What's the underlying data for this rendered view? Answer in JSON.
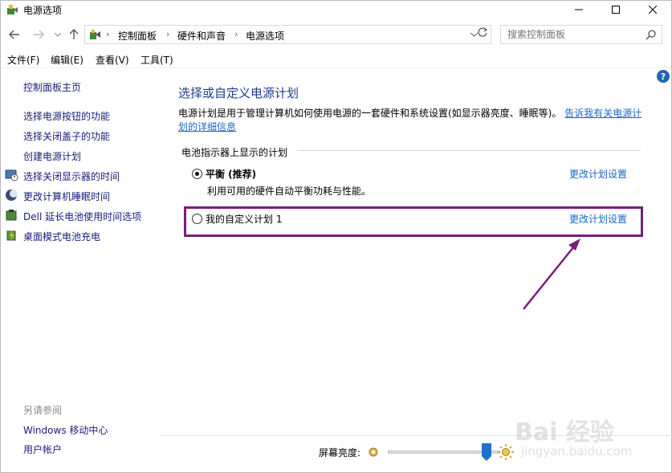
{
  "window": {
    "title": "电源选项"
  },
  "address": {
    "crumbs": [
      "控制面板",
      "硬件和声音",
      "电源选项"
    ],
    "search_placeholder": "搜索控制面板"
  },
  "menu": [
    "文件(F)",
    "编辑(E)",
    "查看(V)",
    "工具(T)"
  ],
  "sidebar": {
    "home": "控制面板主页",
    "items": [
      {
        "label": "选择电源按钮的功能",
        "icon": ""
      },
      {
        "label": "选择关闭盖子的功能",
        "icon": ""
      },
      {
        "label": "创建电源计划",
        "icon": ""
      },
      {
        "label": "选择关闭显示器的时间",
        "icon": "monitor-clock-icon"
      },
      {
        "label": "更改计算机睡眠时间",
        "icon": "moon-icon"
      },
      {
        "label": "Dell 延长电池使用时间选项",
        "icon": "dell-battery-icon"
      },
      {
        "label": "桌面模式电池充电",
        "icon": "battery-charge-icon"
      }
    ],
    "see_also": "另请参阅",
    "see_also_items": [
      "Windows 移动中心",
      "用户帐户"
    ]
  },
  "main": {
    "title": "选择或自定义电源计划",
    "description": "电源计划是用于管理计算机如何使用电源的一套硬件和系统设置(如显示器亮度、睡眠等)。",
    "description_link": "告诉我有关电源计划的详细信息",
    "group_label": "电池指示器上显示的计划",
    "plans": [
      {
        "name": "平衡 (推荐)",
        "desc": "利用可用的硬件自动平衡功耗与性能。",
        "selected": true,
        "link": "更改计划设置"
      },
      {
        "name": "我的自定义计划 1",
        "desc": "",
        "selected": false,
        "link": "更改计划设置"
      }
    ]
  },
  "brightness": {
    "label": "屏幕亮度:",
    "level_percent": 85
  },
  "colors": {
    "accent": "#1a66c8",
    "highlight": "#7a1f7a",
    "title": "#1e3c8c"
  },
  "watermark": {
    "main": "Bai 经验",
    "sub": "jingyan.baidu.com"
  }
}
